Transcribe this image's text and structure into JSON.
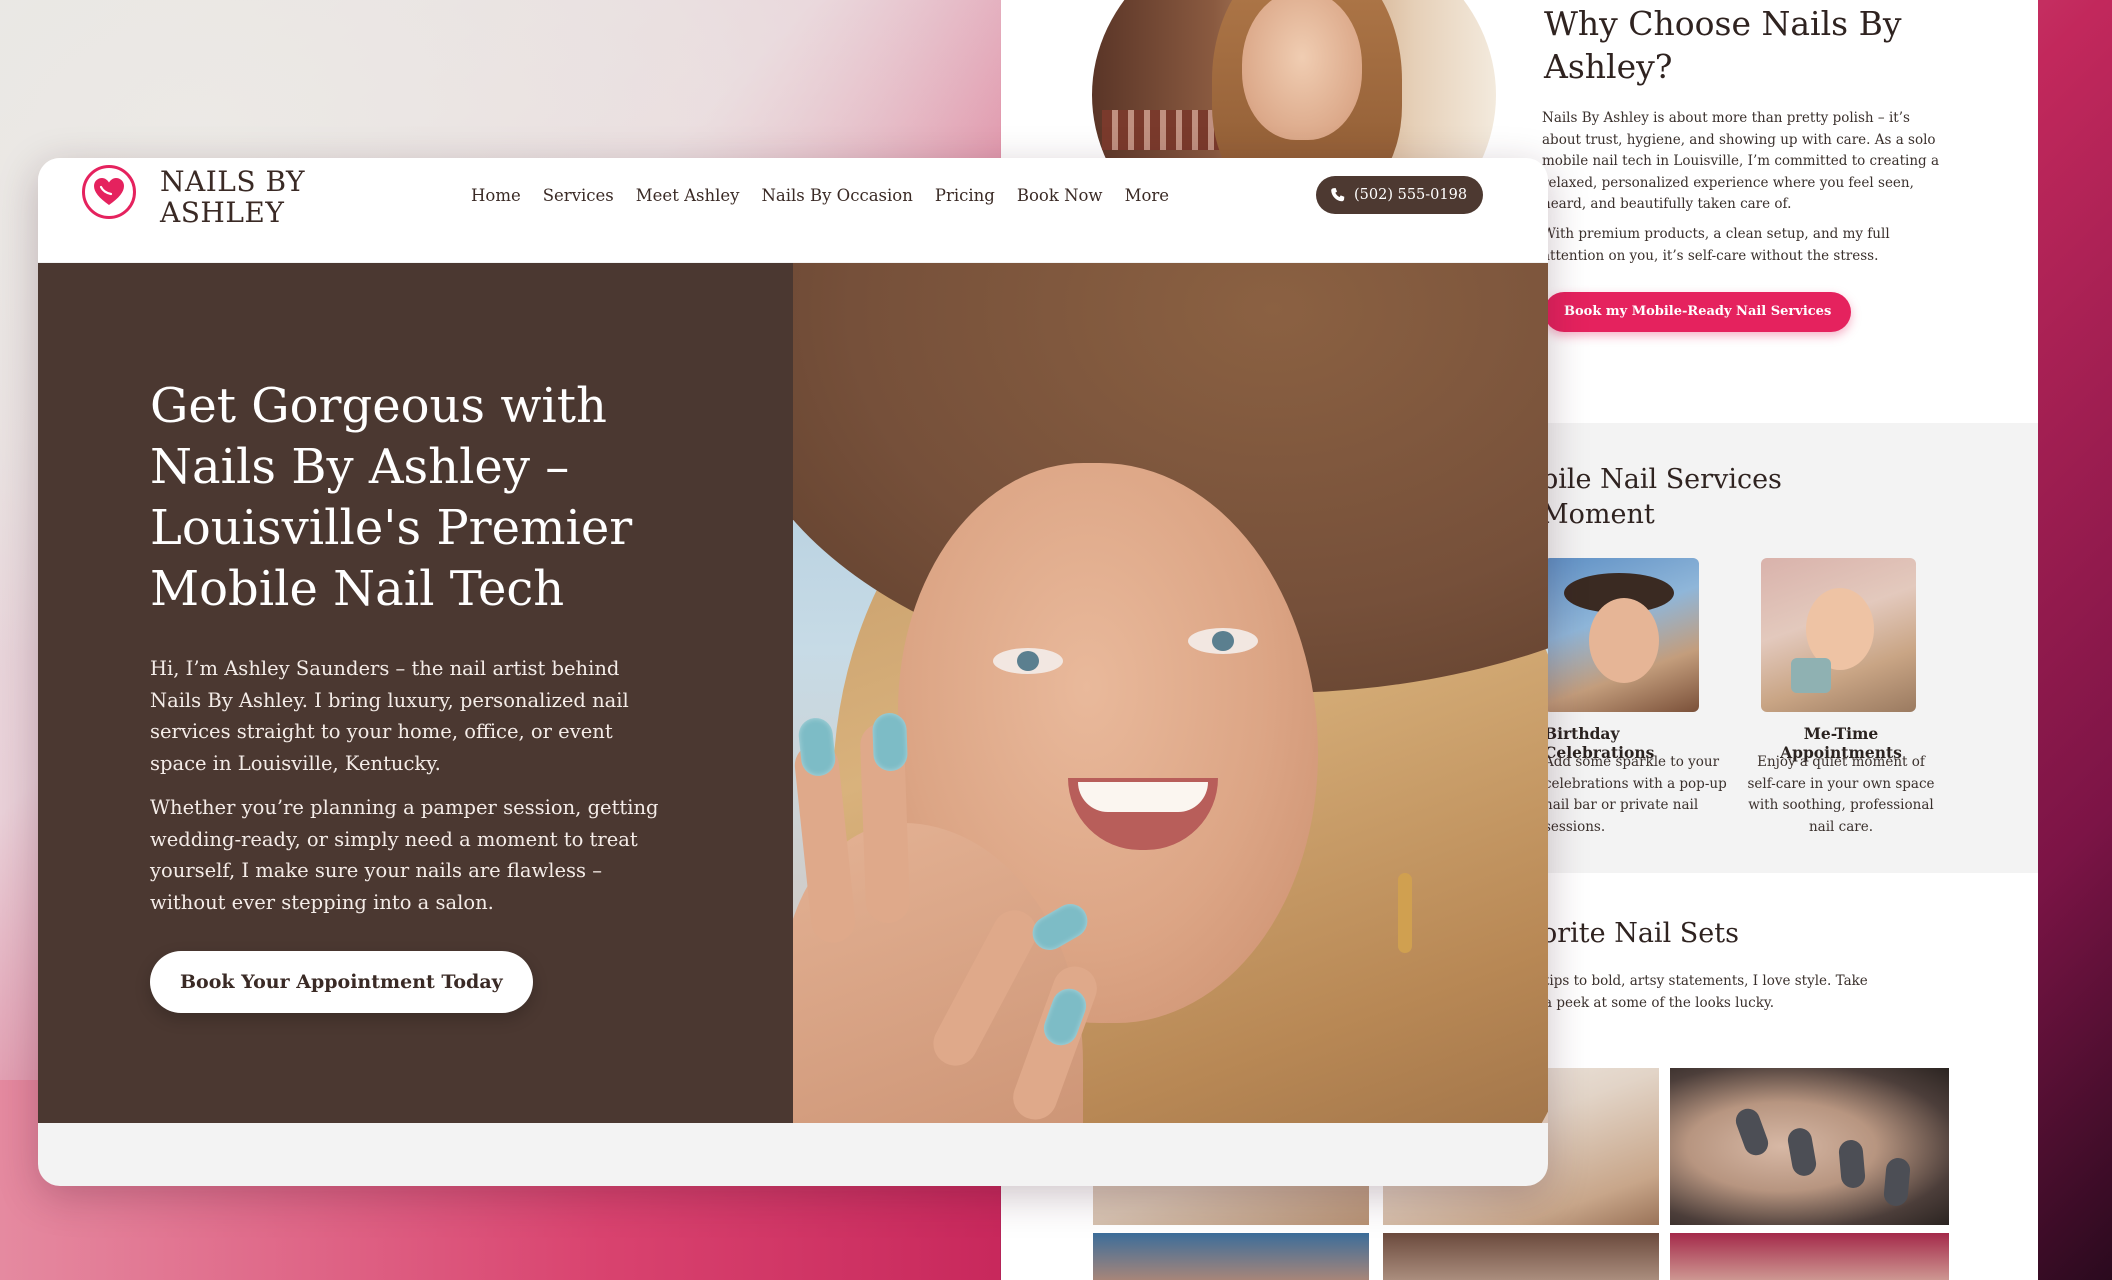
{
  "back_page": {
    "why_title": "Why Choose Nails By Ashley?",
    "why_p1": "Nails By Ashley is about more than pretty polish – it’s about trust, hygiene, and showing up with care. As a solo mobile nail tech in Louisville, I’m committed to creating a relaxed, personalized experience where you feel seen, heard, and beautifully taken care of.",
    "why_p2": "With premium products, a clean setup, and my full attention on you, it’s self-care without the stress.",
    "cta": "Book my Mobile-Ready Nail Services",
    "services_title": "bile Nail Services\nMoment",
    "services": [
      {
        "name": "Birthday Celebrations",
        "desc": "Add some sparkle to your celebrations with a pop-up nail bar or private nail sessions."
      },
      {
        "name": "Me-Time Appointments",
        "desc": "Enjoy a quiet moment of self-care in your own space with soothing, professional nail care."
      }
    ],
    "sets_title": "orite Nail Sets",
    "sets_p": "tips to bold, artsy statements, I love style. Take a peek at some of the looks lucky."
  },
  "header": {
    "brand": "NAILS BY ASHLEY",
    "nav": [
      "Home",
      "Services",
      "Meet Ashley",
      "Nails By Occasion",
      "Pricing",
      "Book Now",
      "More"
    ],
    "phone": "(502) 555-0198"
  },
  "hero": {
    "title": "Get Gorgeous with Nails By Ashley – Louisville's Premier Mobile Nail Tech",
    "p1": "Hi, I’m Ashley Saunders – the nail artist behind Nails By Ashley. I bring luxury, personalized nail services straight to your home, office, or event space in Louisville, Kentucky.",
    "p2": "Whether you’re planning a pamper session, getting wedding-ready, or simply need a moment to treat yourself, I make sure your nails are flawless – without ever stepping into a salon.",
    "cta": "Book Your Appointment Today"
  },
  "colors": {
    "accent": "#e5225e",
    "hero_bg": "#4b3831",
    "phone_bg": "#4d3931"
  },
  "icons": {
    "logo": "heart-logo-icon",
    "phone": "phone-icon"
  }
}
